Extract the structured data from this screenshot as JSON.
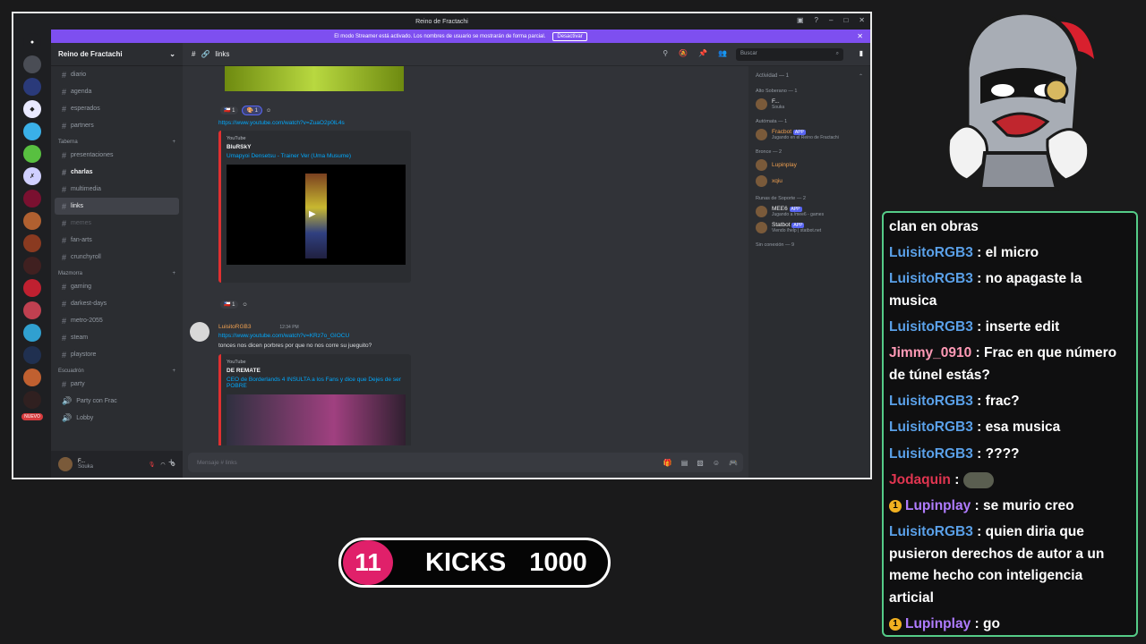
{
  "window": {
    "title": "Reino de Fractachi"
  },
  "banner": {
    "text": "El modo Streamer está activado. Los nombres de usuario se mostrarán de forma parcial.",
    "button": "Desactivar"
  },
  "server": {
    "name": "Reino de Fractachi"
  },
  "channels": [
    {
      "type": "text",
      "label": "diario",
      "style": "normal"
    },
    {
      "type": "text",
      "label": "agenda",
      "style": "normal"
    },
    {
      "type": "text",
      "label": "esperados",
      "style": "normal"
    },
    {
      "type": "text",
      "label": "partners",
      "style": "normal"
    },
    {
      "type": "cat",
      "label": "Taberna"
    },
    {
      "type": "text",
      "label": "presentaciones",
      "style": "normal"
    },
    {
      "type": "text",
      "label": "charlas",
      "style": "bold"
    },
    {
      "type": "text",
      "label": "multimedia",
      "style": "normal"
    },
    {
      "type": "text",
      "label": "links",
      "style": "active"
    },
    {
      "type": "text",
      "label": "memes",
      "style": "dim"
    },
    {
      "type": "text",
      "label": "fan-arts",
      "style": "normal"
    },
    {
      "type": "text",
      "label": "crunchyroll",
      "style": "normal"
    },
    {
      "type": "cat",
      "label": "Mazmorra"
    },
    {
      "type": "text",
      "label": "gaming",
      "style": "normal"
    },
    {
      "type": "text",
      "label": "darkest-days",
      "style": "normal"
    },
    {
      "type": "text",
      "label": "metro-2055",
      "style": "normal"
    },
    {
      "type": "text",
      "label": "steam",
      "style": "normal"
    },
    {
      "type": "text",
      "label": "playstore",
      "style": "normal"
    },
    {
      "type": "cat",
      "label": "Escuadrón"
    },
    {
      "type": "text",
      "label": "party",
      "style": "normal"
    },
    {
      "type": "voice",
      "label": "Party con Frac",
      "style": "normal"
    },
    {
      "type": "voice",
      "label": "Lobby",
      "style": "normal"
    }
  ],
  "user": {
    "name": "F...",
    "status": "Souka"
  },
  "header": {
    "channel": "links",
    "search_placeholder": "Buscar"
  },
  "messages": {
    "link1": "https://www.youtube.com/watch?v=ZuaO2p0lL4s",
    "embed1": {
      "site": "YouTube",
      "author": "BluRSkY",
      "title": "Umapyoi Densetsu - Trainer Ver (Uma Musume)"
    },
    "author": "LuisitoRGB3",
    "time": "12:34 PM",
    "link2": "https://www.youtube.com/watch?v=KRz7o_GIOCU",
    "text": "tonces nos dicen porbres por que no nos corre su jueguito?",
    "embed2": {
      "site": "YouTube",
      "author": "DE REMATE",
      "title": "CEO de Borderlands 4 INSULTA a los Fans y dice que Dejes de ser POBRE"
    },
    "reaction_count": "1",
    "composer": "Mensaje # links"
  },
  "members": {
    "activity": "Actividad — 1",
    "groups": [
      {
        "title": "Alto Soberano — 1",
        "items": [
          {
            "name": "F...",
            "sub": "Souka",
            "color": "#f2f3f5"
          }
        ]
      },
      {
        "title": "Autómata — 1",
        "items": [
          {
            "name": "Fracbot",
            "sub": "Jugando en el Reino de Fractachi",
            "color": "#f0a050",
            "app": "APP"
          }
        ]
      },
      {
        "title": "Bronce — 2",
        "items": [
          {
            "name": "Lupinplay",
            "sub": "",
            "color": "#f0a050"
          },
          {
            "name": "xqiu",
            "sub": "",
            "color": "#f0a050"
          }
        ]
      },
      {
        "title": "Runas de Soporte — 2",
        "items": [
          {
            "name": "MEE6",
            "sub": "Jugando a /mee6 - games",
            "color": "#f2f3f5",
            "app": "APP"
          },
          {
            "name": "Statbot",
            "sub": "Viendo /help | statbot.net",
            "color": "#f2f3f5",
            "app": "APP"
          }
        ]
      },
      {
        "title": "Sin conexión — 9",
        "items": []
      }
    ]
  },
  "chat": [
    {
      "user": "",
      "text": "clan en obras",
      "color": ""
    },
    {
      "user": "LuisitoRGB3",
      "text": "el micro",
      "color": "blue"
    },
    {
      "user": "LuisitoRGB3",
      "text": "no apagaste la musica",
      "color": "blue"
    },
    {
      "user": "LuisitoRGB3",
      "text": "inserte edit",
      "color": "blue"
    },
    {
      "user": "Jimmy_0910",
      "text": "Frac en que número de túnel estás?",
      "color": "pink"
    },
    {
      "user": "LuisitoRGB3",
      "text": "frac?",
      "color": "blue"
    },
    {
      "user": "LuisitoRGB3",
      "text": "esa musica",
      "color": "blue"
    },
    {
      "user": "LuisitoRGB3",
      "text": "????",
      "color": "blue"
    },
    {
      "user": "Jodaquin",
      "text": "",
      "color": "red",
      "emote": true
    },
    {
      "user": "Lupinplay",
      "text": "se murio creo",
      "color": "purple",
      "badge": "1"
    },
    {
      "user": "LuisitoRGB3",
      "text": "quien diria que pusieron derechos de autor a un meme hecho con inteligencia articial",
      "color": "blue"
    },
    {
      "user": "Lupinplay",
      "text": "go",
      "color": "purple",
      "badge": "1"
    }
  ],
  "kicks": {
    "count": "11",
    "label": "KICKS",
    "goal": "1000"
  },
  "colors": {
    "accent": "#7e4ff0",
    "kicks_pink": "#e0206a",
    "chat_border": "#55cc88"
  }
}
